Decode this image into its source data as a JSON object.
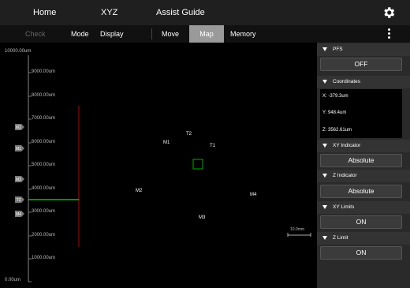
{
  "topnav": {
    "tabs": [
      {
        "label": "Home"
      },
      {
        "label": "XYZ"
      },
      {
        "label": "Assist Guide"
      }
    ]
  },
  "subnav": {
    "items": [
      {
        "label": "Check",
        "enabled": false
      },
      {
        "label": "Mode",
        "enabled": true
      },
      {
        "label": "Display",
        "enabled": true
      },
      {
        "label": "Move",
        "enabled": true
      },
      {
        "label": "Map",
        "enabled": true,
        "selected": true
      },
      {
        "label": "Memory",
        "enabled": true
      }
    ]
  },
  "map": {
    "z_ticks": [
      "10000.00um",
      "9000.00um",
      "8000.00um",
      "7000.00um",
      "6000.00um",
      "5000.00um",
      "4000.00um",
      "3000.00um",
      "2000.00um",
      "1000.00um",
      "0.00um"
    ],
    "z_markers": [
      {
        "label": "M2"
      },
      {
        "label": "M1"
      },
      {
        "label": "M3"
      },
      {
        "label": "T2"
      },
      {
        "label": "M4"
      }
    ],
    "memory_points": [
      {
        "label": "M1"
      },
      {
        "label": "T2"
      },
      {
        "label": "T1"
      },
      {
        "label": "M2"
      },
      {
        "label": "M4"
      },
      {
        "label": "M3"
      }
    ],
    "scale_bar_label": "10.0mm",
    "colors": {
      "z_indicator": "#00c800",
      "z_limit": "#c00000",
      "crosshair": "#ffffff",
      "current_box": "#00aa00"
    }
  },
  "panel": {
    "pfs": {
      "title": "PFS",
      "button": "OFF"
    },
    "coordinates": {
      "title": "Coordinates",
      "x": "X: -379.3um",
      "y": "Y: 948.4um",
      "z": "Z: 3562.61um"
    },
    "xy_indicator": {
      "title": "XY Indicator",
      "button": "Absolute"
    },
    "z_indicator": {
      "title": "Z Indicator",
      "button": "Absolute"
    },
    "xy_limits": {
      "title": "XY Limits",
      "button": "ON"
    },
    "z_limit": {
      "title": "Z Limit",
      "button": "ON"
    }
  }
}
